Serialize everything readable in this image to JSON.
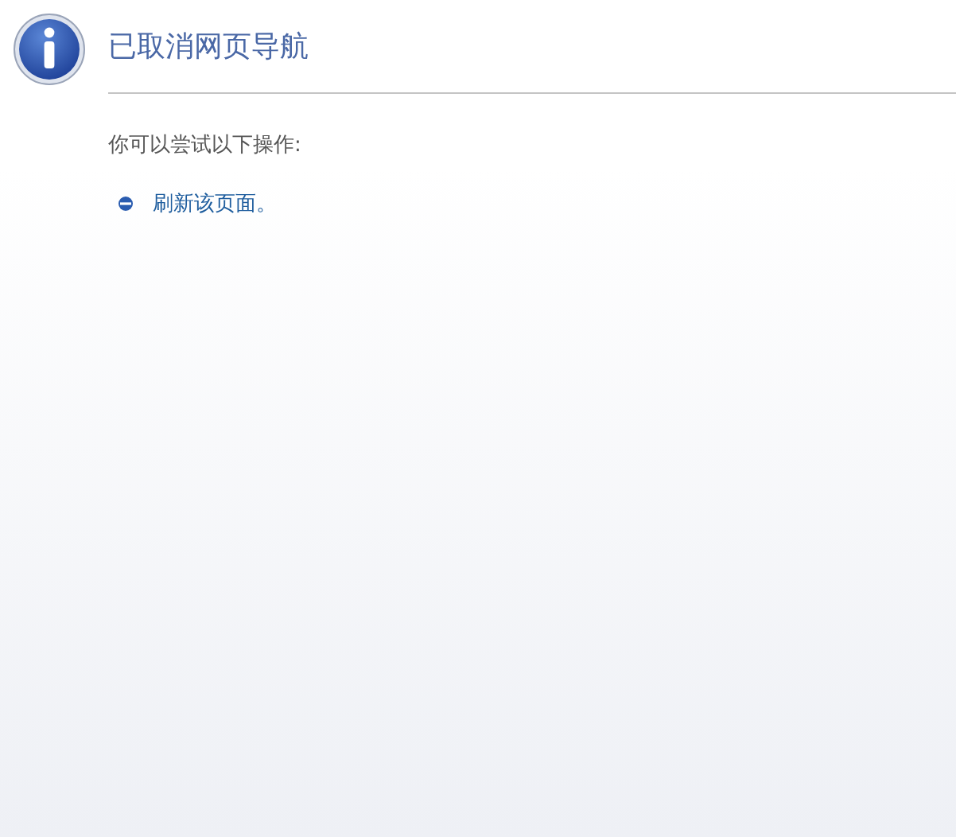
{
  "heading": "已取消网页导航",
  "intro": "你可以尝试以下操作:",
  "actions": [
    {
      "label": "刷新该页面。"
    }
  ]
}
